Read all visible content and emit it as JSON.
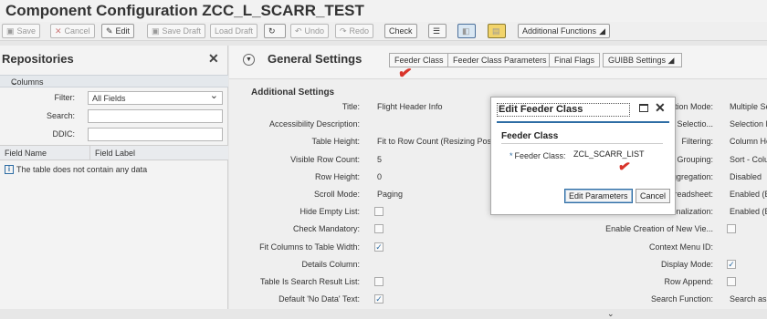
{
  "title": "Component Configuration ZCC_L_SCARR_TEST",
  "toolbar": {
    "save": "Save",
    "cancel": "Cancel",
    "edit": "Edit",
    "save_draft": "Save Draft",
    "load_draft": "Load Draft",
    "undo": "Undo",
    "redo": "Redo",
    "check": "Check",
    "additional_functions": "Additional Functions"
  },
  "left": {
    "title": "Repositories",
    "columns_label": "Columns",
    "filter_label": "Filter:",
    "filter_value": "All Fields",
    "search_label": "Search:",
    "search_value": "",
    "ddic_label": "DDIC:",
    "ddic_value": "",
    "col_field_name": "Field Name",
    "col_field_label": "Field Label",
    "empty_text": "The table does not contain any data"
  },
  "settings": {
    "title": "General Settings",
    "buttons": [
      "Feeder Class",
      "Feeder Class Parameters",
      "Final Flags",
      "GUIBB Settings"
    ],
    "sub_title": "Additional Settings",
    "props_left": [
      {
        "label": "Title:",
        "value": "Flight Header Info"
      },
      {
        "label": "Accessibility Description:",
        "value": ""
      },
      {
        "label": "Table Height:",
        "value": "Fit to Row Count (Resizing Poss"
      },
      {
        "label": "Visible Row Count:",
        "value": "5"
      },
      {
        "label": "Row Height:",
        "value": "0"
      },
      {
        "label": "Scroll Mode:",
        "value": "Paging"
      },
      {
        "label": "Hide Empty List:",
        "value": ""
      },
      {
        "label": "Check Mandatory:",
        "value": ""
      },
      {
        "label": "Fit Columns to Table Width:",
        "value": ""
      },
      {
        "label": "Details Column:",
        "value": ""
      },
      {
        "label": "Table Is Search Result List:",
        "value": ""
      },
      {
        "label": "Default 'No Data' Text:",
        "value": ""
      }
    ],
    "props_right": [
      {
        "label": "ction Mode:",
        "value": "Multiple Se"
      },
      {
        "label": "All Selectio...",
        "value": "Selection F"
      },
      {
        "label": "Filtering:",
        "value": "Column He"
      },
      {
        "label": "Grouping:",
        "value": "Sort - Colu"
      },
      {
        "label": "ggregation:",
        "value": "Disabled"
      },
      {
        "label": "readsheet:",
        "value": "Enabled (E"
      },
      {
        "label": "sonalization:",
        "value": "Enabled (E"
      },
      {
        "label": "Enable Creation of New Vie...",
        "value": ""
      },
      {
        "label": "Context Menu ID:",
        "value": ""
      },
      {
        "label": "Display Mode:",
        "value": ""
      },
      {
        "label": "Row Append:",
        "value": ""
      },
      {
        "label": "Search Function:",
        "value": "Search as F"
      }
    ]
  },
  "dialog": {
    "title": "Edit Feeder Class",
    "section": "Feeder Class",
    "field_label": "Feeder Class:",
    "field_value": "ZCL_SCARR_LIST",
    "edit_params": "Edit Parameters",
    "cancel": "Cancel"
  }
}
